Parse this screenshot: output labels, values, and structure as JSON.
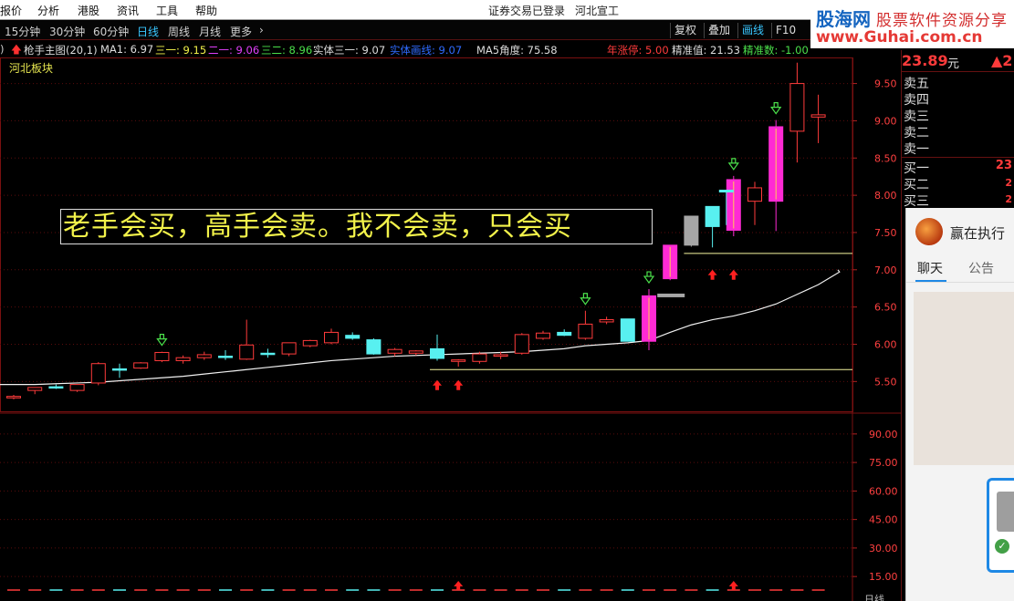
{
  "menu": {
    "items": [
      "报价",
      "分析",
      "港股",
      "资讯",
      "工具",
      "帮助"
    ],
    "login_status": "证券交易已登录",
    "stock_name": "河北宣工"
  },
  "toolbar": {
    "periods": [
      "15分钟",
      "30分钟",
      "60分钟",
      "日线",
      "周线",
      "月线",
      "更多"
    ],
    "active_period": "日线",
    "more_arrow": "›",
    "right_buttons": [
      "复权",
      "叠加",
      "画线",
      "F10"
    ],
    "active_right_button": "画线"
  },
  "infoline": {
    "prefix": ")",
    "indicator_name": "枪手主图(20,1)",
    "ma1_label": "MA1: 6.97",
    "san_yi": "三一: 9.15",
    "er_yi": "二一: 9.06",
    "san_er": "三二: 8.96",
    "shiti_san_yi": "实体三一: 9.07",
    "shiti_lines": "实体画线: 9.07",
    "ma5_angle": "MA5角度: 75.58",
    "annual_limit": "年涨停: 5.00",
    "accuracy_value": "精准值: 21.53",
    "accuracy_count": "精准数: -1.00"
  },
  "sector_label": "河北板块",
  "motto": "老手会买，高手会卖。我不会卖，只会买",
  "watermark": {
    "brand": "股海网",
    "slogan": "股票软件资源分享",
    "url": "www.Guhai.com.cn"
  },
  "quote": {
    "price": "23.89",
    "unit": "元",
    "change": "▲2",
    "orderbook_sell": [
      "卖五",
      "卖四",
      "卖三",
      "卖二",
      "卖一"
    ],
    "orderbook_buy": [
      "买一",
      "买二",
      "买三"
    ],
    "buy_values": [
      "23",
      "2",
      "2"
    ]
  },
  "chat": {
    "title": "赢在执行",
    "tab_chat": "聊天",
    "tab_notice": "公告",
    "check_icon": "✓"
  },
  "bottom_label": "日线",
  "chart_data": {
    "type": "candlestick",
    "price_axis_ticks": [
      "9.50",
      "9.00",
      "8.50",
      "8.00",
      "7.50",
      "7.00",
      "6.50",
      "6.00",
      "5.50"
    ],
    "price_ylim": [
      5.1,
      9.85
    ],
    "indicator_axis_ticks": [
      "90.00",
      "75.00",
      "60.00",
      "45.00",
      "30.00",
      "15.00"
    ],
    "indicator_ylim": [
      5,
      100
    ],
    "candles": [
      {
        "o": 5.3,
        "h": 5.32,
        "l": 5.26,
        "c": 5.28,
        "color": "red"
      },
      {
        "o": 5.38,
        "h": 5.42,
        "l": 5.33,
        "c": 5.42,
        "color": "red"
      },
      {
        "o": 5.42,
        "h": 5.46,
        "l": 5.4,
        "c": 5.43,
        "color": "cyan"
      },
      {
        "o": 5.38,
        "h": 5.46,
        "l": 5.36,
        "c": 5.46,
        "color": "red"
      },
      {
        "o": 5.48,
        "h": 5.76,
        "l": 5.45,
        "c": 5.74,
        "color": "red"
      },
      {
        "o": 5.66,
        "h": 5.74,
        "l": 5.55,
        "c": 5.67,
        "color": "cyan"
      },
      {
        "o": 5.68,
        "h": 5.76,
        "l": 5.67,
        "c": 5.75,
        "color": "red"
      },
      {
        "o": 5.78,
        "h": 5.9,
        "l": 5.76,
        "c": 5.89,
        "color": "red"
      },
      {
        "o": 5.78,
        "h": 5.85,
        "l": 5.74,
        "c": 5.82,
        "color": "red"
      },
      {
        "o": 5.82,
        "h": 5.9,
        "l": 5.79,
        "c": 5.86,
        "color": "red"
      },
      {
        "o": 5.84,
        "h": 5.92,
        "l": 5.79,
        "c": 5.83,
        "color": "cyan"
      },
      {
        "o": 5.8,
        "h": 6.33,
        "l": 5.79,
        "c": 5.99,
        "color": "red"
      },
      {
        "o": 5.88,
        "h": 5.94,
        "l": 5.82,
        "c": 5.87,
        "color": "cyan"
      },
      {
        "o": 5.87,
        "h": 6.02,
        "l": 5.84,
        "c": 6.02,
        "color": "red"
      },
      {
        "o": 5.98,
        "h": 6.06,
        "l": 5.96,
        "c": 6.05,
        "color": "red"
      },
      {
        "o": 6.02,
        "h": 6.21,
        "l": 6.0,
        "c": 6.16,
        "color": "red"
      },
      {
        "o": 6.12,
        "h": 6.16,
        "l": 6.06,
        "c": 6.08,
        "color": "cyan"
      },
      {
        "o": 6.06,
        "h": 6.08,
        "l": 5.86,
        "c": 5.87,
        "color": "cyan"
      },
      {
        "o": 5.88,
        "h": 5.95,
        "l": 5.84,
        "c": 5.93,
        "color": "red"
      },
      {
        "o": 5.88,
        "h": 5.92,
        "l": 5.85,
        "c": 5.91,
        "color": "red"
      },
      {
        "o": 5.94,
        "h": 6.13,
        "l": 5.78,
        "c": 5.81,
        "color": "cyan"
      },
      {
        "o": 5.77,
        "h": 5.8,
        "l": 5.7,
        "c": 5.79,
        "color": "red"
      },
      {
        "o": 5.77,
        "h": 5.9,
        "l": 5.74,
        "c": 5.87,
        "color": "red"
      },
      {
        "o": 5.84,
        "h": 5.9,
        "l": 5.8,
        "c": 5.86,
        "color": "red"
      },
      {
        "o": 5.88,
        "h": 6.15,
        "l": 5.86,
        "c": 6.13,
        "color": "red"
      },
      {
        "o": 6.08,
        "h": 6.18,
        "l": 6.06,
        "c": 6.15,
        "color": "red"
      },
      {
        "o": 6.16,
        "h": 6.2,
        "l": 6.11,
        "c": 6.12,
        "color": "cyan"
      },
      {
        "o": 6.08,
        "h": 6.45,
        "l": 6.06,
        "c": 6.27,
        "color": "red"
      },
      {
        "o": 6.3,
        "h": 6.37,
        "l": 6.27,
        "c": 6.33,
        "color": "red"
      },
      {
        "o": 6.34,
        "h": 6.34,
        "l": 6.04,
        "c": 6.04,
        "color": "cyan"
      },
      {
        "o": 6.04,
        "h": 6.74,
        "l": 5.92,
        "c": 6.65,
        "color": "magenta"
      },
      {
        "o": 6.88,
        "h": 7.33,
        "l": 6.86,
        "c": 7.33,
        "color": "magenta"
      },
      {
        "o": 7.72,
        "h": 7.72,
        "l": 7.31,
        "c": 7.33,
        "color": "gray"
      },
      {
        "o": 7.58,
        "h": 7.85,
        "l": 7.3,
        "c": 7.85,
        "color": "cyan"
      },
      {
        "o": 7.53,
        "h": 8.26,
        "l": 7.45,
        "c": 8.21,
        "color": "magenta"
      },
      {
        "o": 7.92,
        "h": 8.18,
        "l": 7.6,
        "c": 8.1,
        "color": "red"
      },
      {
        "o": 8.92,
        "h": 9.01,
        "l": 7.52,
        "c": 7.92,
        "color": "magenta"
      },
      {
        "o": 9.5,
        "h": 9.78,
        "l": 8.44,
        "c": 8.86,
        "color": "red"
      },
      {
        "o": 9.08,
        "h": 9.35,
        "l": 8.7,
        "c": 9.05,
        "color": "red"
      }
    ],
    "ma_line": [
      5.46,
      5.46,
      5.47,
      5.48,
      5.49,
      5.51,
      5.53,
      5.55,
      5.57,
      5.6,
      5.63,
      5.66,
      5.69,
      5.72,
      5.75,
      5.78,
      5.8,
      5.82,
      5.84,
      5.85,
      5.86,
      5.87,
      5.88,
      5.89,
      5.9,
      5.92,
      5.94,
      5.98,
      6.0,
      6.02,
      6.05,
      6.16,
      6.26,
      6.33,
      6.38,
      6.45,
      6.54,
      6.67,
      6.8,
      6.97
    ],
    "support_lines": [
      {
        "value": 5.66,
        "from": 20,
        "to": 39
      },
      {
        "value": 7.22,
        "from": 32,
        "to": 39
      }
    ],
    "down_signal_candles": [
      7,
      27,
      30,
      34,
      36,
      37
    ],
    "up_signal_candles": [
      20,
      21,
      33,
      34
    ]
  }
}
